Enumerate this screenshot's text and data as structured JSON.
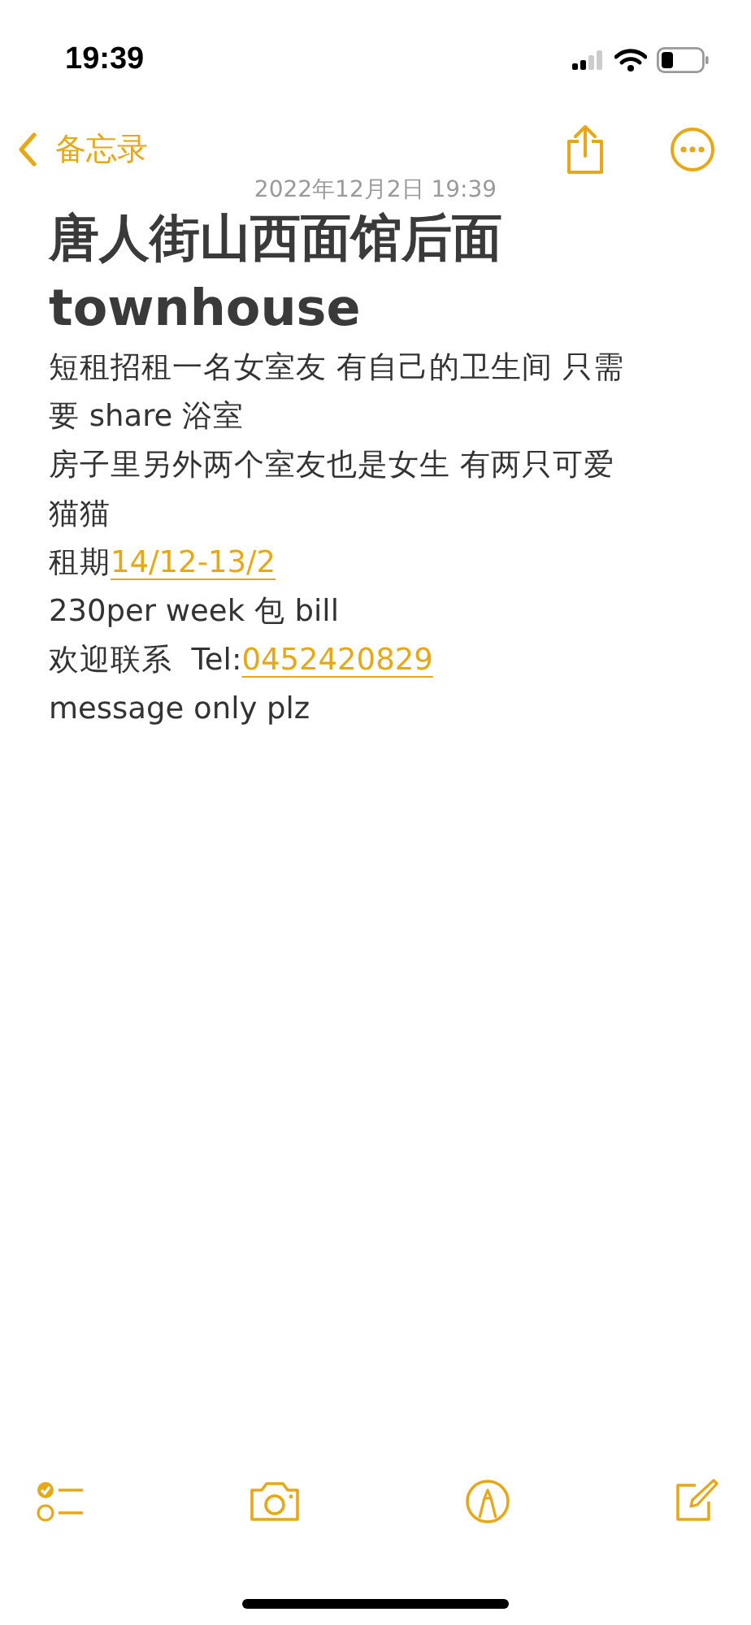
{
  "status_bar": {
    "time": "19:39"
  },
  "nav": {
    "back_label": "备忘录"
  },
  "note": {
    "date": "2022年12月2日 19:39",
    "title_lines": [
      "唐人街山西面馆后面",
      "townhouse"
    ],
    "lines": [
      {
        "text": "短租招租一名女室友 有自己的卫生间 只需"
      },
      {
        "text": "要 share 浴室"
      },
      {
        "text": "房子里另外两个室友也是女生 有两只可爱"
      },
      {
        "text": "猫猫"
      },
      {
        "text": "租期",
        "link": "14/12-13/2"
      },
      {
        "text": "230per week 包 bill"
      },
      {
        "text": "欢迎联系  Tel:",
        "link": "0452420829"
      },
      {
        "text": "message only plz"
      }
    ]
  }
}
